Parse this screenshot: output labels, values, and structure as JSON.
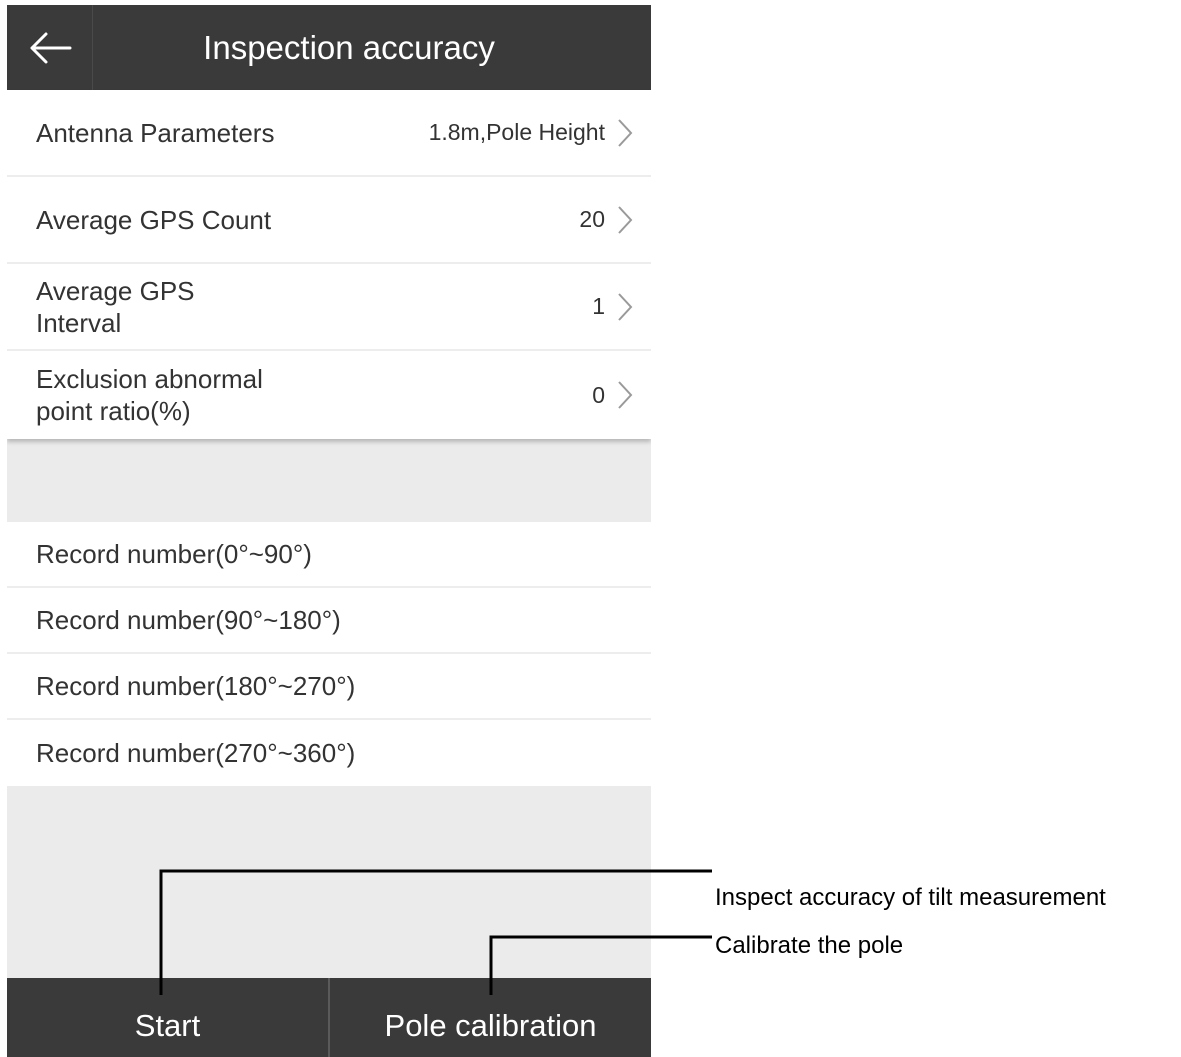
{
  "header": {
    "title": "Inspection accuracy",
    "back_icon": "arrow-left-icon"
  },
  "settings": [
    {
      "label": "Antenna Parameters",
      "value": "1.8m,Pole Height"
    },
    {
      "label": "Average GPS Count",
      "value": "20"
    },
    {
      "label": "Average GPS\nInterval",
      "value": "1"
    },
    {
      "label": "Exclusion abnormal\npoint ratio(%)",
      "value": "0"
    }
  ],
  "records": [
    "Record number(0°~90°)",
    "Record number(90°~180°)",
    "Record number(180°~270°)",
    "Record number(270°~360°)"
  ],
  "footer": {
    "start_label": "Start",
    "pole_calibration_label": "Pole calibration"
  },
  "annotations": {
    "start": "Inspect accuracy of tilt measurement",
    "pole_calibration": "Calibrate the pole"
  },
  "colors": {
    "bar_background": "#3a3a3a",
    "screen_background": "#ebebeb"
  }
}
